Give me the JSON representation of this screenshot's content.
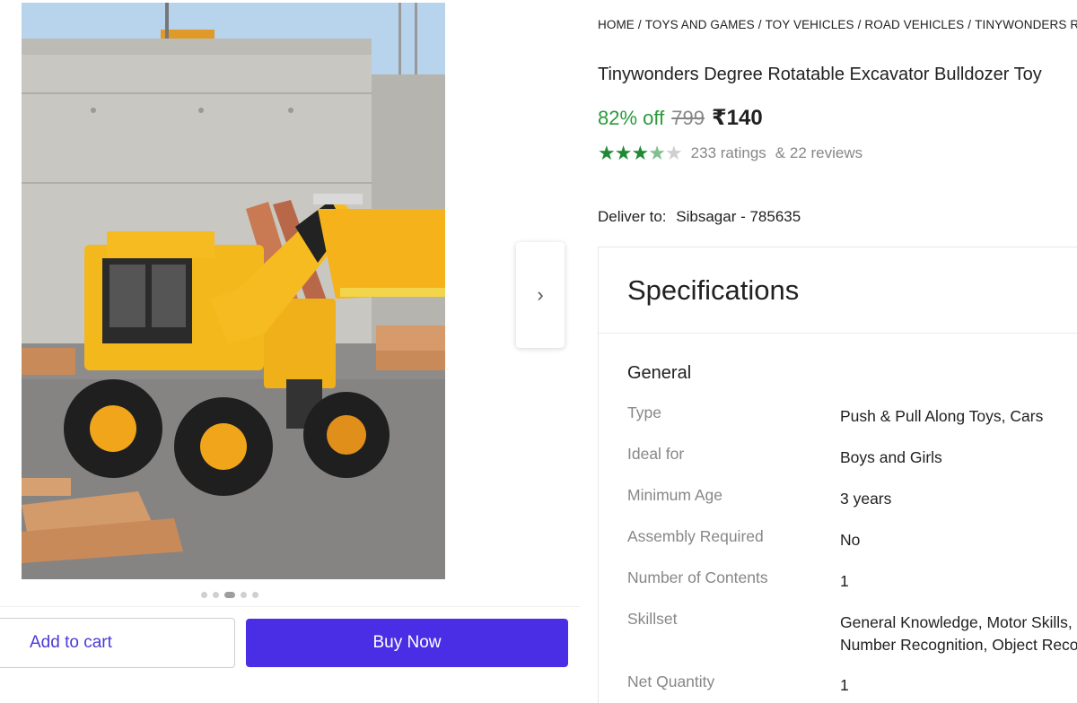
{
  "breadcrumb": [
    "HOME",
    "TOYS AND GAMES",
    "TOY VEHICLES",
    "ROAD VEHICLES",
    "TINYWONDERS ROAD"
  ],
  "product": {
    "title": "Tinywonders Degree Rotatable Excavator Bulldozer Toy",
    "discount": "82% off",
    "mrp": "799",
    "price": "₹140",
    "rating": 3.5,
    "ratings_text": "233 ratings",
    "reviews_text": "& 22 reviews"
  },
  "delivery": {
    "label": "Deliver to:",
    "place": "Sibsagar - 785635"
  },
  "gallery": {
    "active_index": 2,
    "count": 5,
    "image_icon": "excavator-toy-photo"
  },
  "actions": {
    "add_to_cart": "Add to cart",
    "buy_now": "Buy Now",
    "next_icon": "chevron-right-icon"
  },
  "specs": {
    "heading": "Specifications",
    "group": "General",
    "rows": [
      {
        "key": "Type",
        "value": "Push & Pull Along Toys, Cars"
      },
      {
        "key": "Ideal for",
        "value": "Boys and Girls"
      },
      {
        "key": "Minimum Age",
        "value": "3 years"
      },
      {
        "key": "Assembly Required",
        "value": "No"
      },
      {
        "key": "Number of Contents",
        "value": "1"
      },
      {
        "key": "Skillset",
        "value": "General Knowledge, Motor Skills,",
        "value2": "Number Recognition, Object Reco"
      },
      {
        "key": "Net Quantity",
        "value": "1"
      }
    ]
  },
  "colors": {
    "accent": "#4a2ee6",
    "discount": "#2a9a3a",
    "star": "#1f8a33"
  }
}
